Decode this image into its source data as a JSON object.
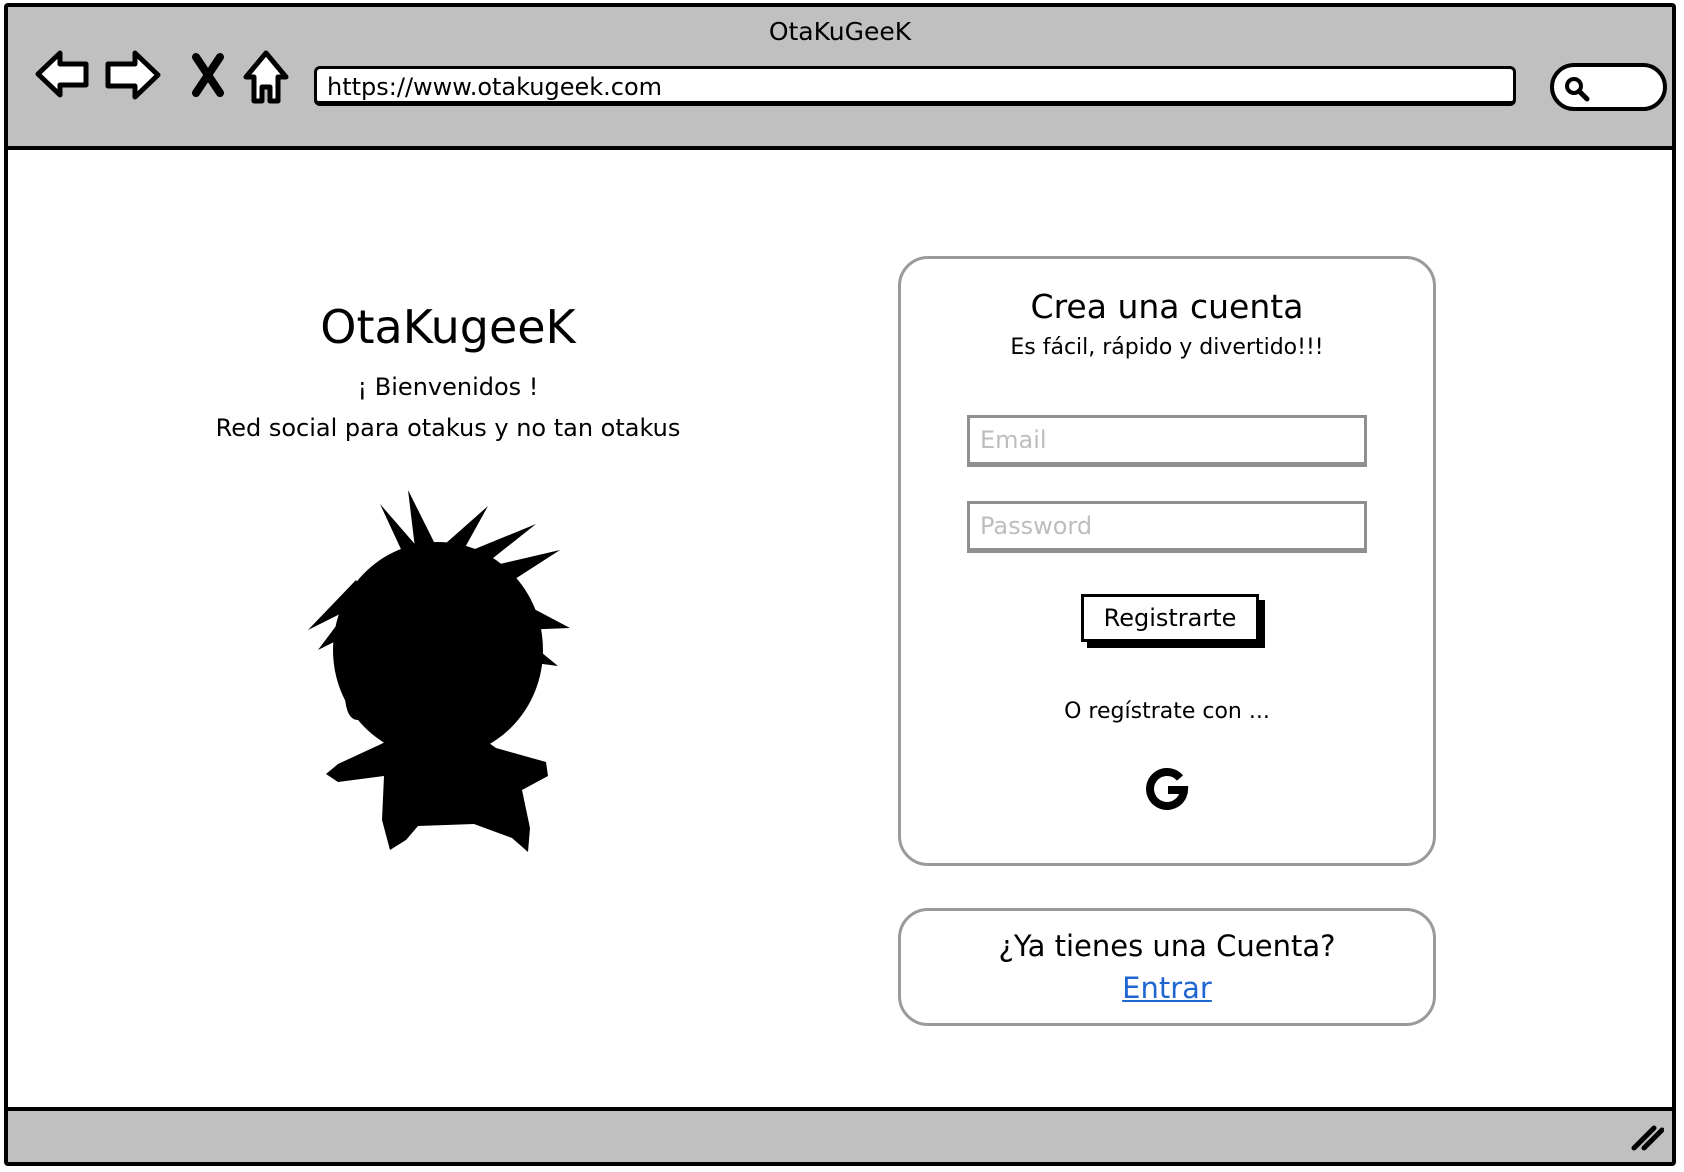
{
  "window": {
    "title": "OtaKuGeeK"
  },
  "browser": {
    "url": "https://www.otakugeek.com",
    "icons": [
      "back-arrow-icon",
      "forward-arrow-icon",
      "close-x-icon",
      "home-icon",
      "search-icon"
    ]
  },
  "landing": {
    "brand": "OtaKugeeK",
    "welcome": "¡ Bienvenidos !",
    "tagline": "Red social para otakus y no tan otakus",
    "illustration": "anime-character-silhouette"
  },
  "signup": {
    "title": "Crea una cuenta",
    "subtitle": "Es fácil, rápido y divertido!!!",
    "email_placeholder": "Email",
    "password_placeholder": "Password",
    "submit_label": "Registrarte",
    "alt_text": "O regístrate con ...",
    "alt_provider_icon": "google-icon"
  },
  "login": {
    "question": "¿Ya tienes una Cuenta?",
    "link_label": "Entrar",
    "link_color": "#1f66d1"
  }
}
